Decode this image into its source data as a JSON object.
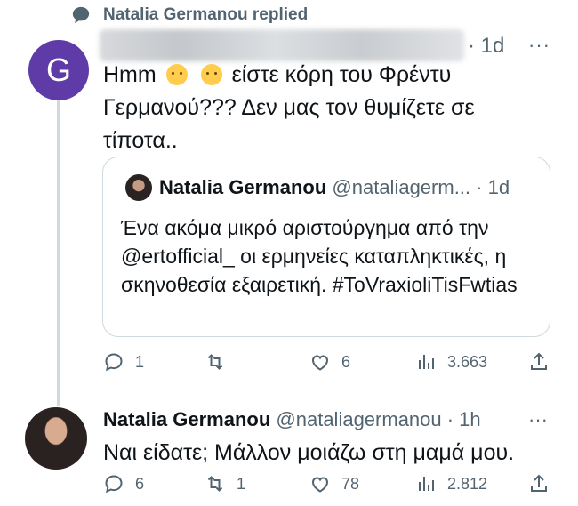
{
  "header": {
    "replied_label": "Natalia Germanou replied"
  },
  "reply_tweet": {
    "time": "· 1d",
    "more": "···",
    "text_part1": "Hmm",
    "text_part2": "είστε κόρη του Φρέντυ Γερμανού??? Δεν μας τον θυμίζετε σε τίποτα..",
    "emoji_icon": "thinking-face-emoji"
  },
  "quoted_tweet": {
    "name": "Natalia Germanou",
    "handle_time": "@nataliagerm... · 1d",
    "text": "Ένα ακόμα μικρό αριστούργημα από την @ertofficial_ οι ερμηνείες καταπληκτικές, η σκηνοθεσία εξαιρετική.  #ToVraxioliTisFwtias"
  },
  "reply_actions": {
    "replies": "1",
    "retweets": "",
    "likes": "6",
    "views": "3.663"
  },
  "reply2": {
    "name": "Natalia Germanou",
    "handle_time": "@nataliagermanou · 1h",
    "more": "···",
    "text": "Ναι είδατε; Μάλλον μοιάζω στη μαμά μου."
  },
  "reply2_actions": {
    "replies": "6",
    "retweets": "1",
    "likes": "78",
    "views": "2.812"
  },
  "colors": {
    "avatar_g": "#5f3ba8",
    "muted": "#536471",
    "line": "#cfd9de"
  },
  "avatar_letter": "G"
}
